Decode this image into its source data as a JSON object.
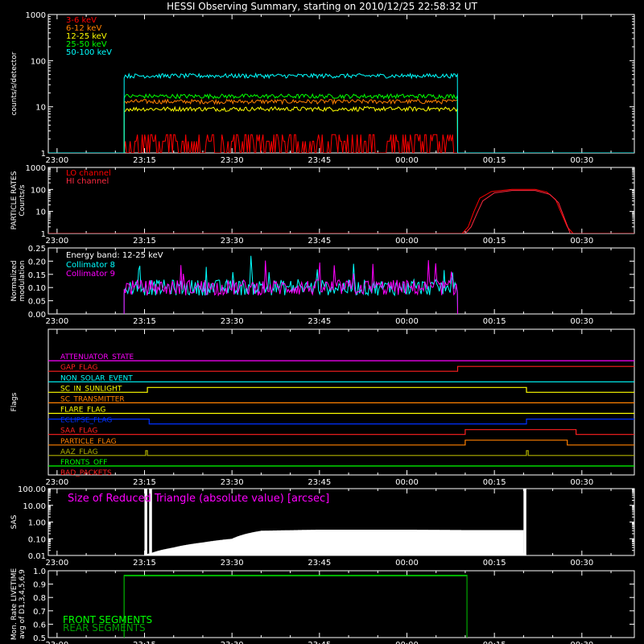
{
  "title": "HESSI Observing Summary, starting on 2010/12/25 22:58:32 UT",
  "colors": {
    "background": "#000000",
    "axis": "#ffffff",
    "red": "#ff0000",
    "orange": "#ff8000",
    "yellow": "#ffff00",
    "green": "#00ff00",
    "cyan": "#00ffff",
    "magenta": "#ff00ff",
    "dark_red": "#ff2a40",
    "blue": "#0030ff",
    "dark_green": "#00a000",
    "olive": "#b0b000"
  },
  "chart_data": [
    {
      "id": "count-rates",
      "type": "line",
      "ylabel": "counts/s/detector",
      "yscale": "log",
      "ylim": [
        1,
        1000
      ],
      "yticks": [
        1,
        10,
        100,
        1000
      ],
      "ytick_labels": [
        "1",
        "10",
        "100",
        "1000"
      ],
      "xlim": [
        -1.5,
        99
      ],
      "xticks": [
        0,
        15,
        30,
        45,
        60,
        75,
        90
      ],
      "xtick_labels": [
        "23:00",
        "23:15",
        "23:30",
        "23:45",
        "00:00",
        "00:15",
        "00:30"
      ],
      "series": [
        {
          "name": "3-6 keV",
          "color": "#ff0000",
          "x": [
            -1.5,
            11.5,
            11.5,
            68.7,
            68.7,
            99
          ],
          "y": [
            1,
            1,
            2.5,
            2.5,
            1,
            1
          ],
          "noise": 1
        },
        {
          "name": "6-12 keV",
          "color": "#ff8000",
          "x": [
            -1.5,
            11.5,
            11.5,
            68.7,
            68.7,
            99
          ],
          "y": [
            1,
            1,
            13,
            13,
            1,
            1
          ]
        },
        {
          "name": "12-25 keV",
          "color": "#ffff00",
          "x": [
            -1.5,
            11.5,
            11.5,
            68.7,
            68.7,
            99
          ],
          "y": [
            1,
            1,
            9,
            9,
            1,
            1
          ]
        },
        {
          "name": "25-50 keV",
          "color": "#00ff00",
          "x": [
            -1.5,
            11.5,
            11.5,
            68.7,
            68.7,
            99
          ],
          "y": [
            1,
            1,
            17,
            17,
            1,
            1
          ]
        },
        {
          "name": "50-100 keV",
          "color": "#00ffff",
          "x": [
            -1.5,
            11.5,
            11.5,
            68.7,
            68.7,
            99
          ],
          "y": [
            1,
            1,
            47,
            47,
            1,
            1
          ]
        }
      ]
    },
    {
      "id": "particle-rates",
      "type": "line",
      "ylabel": [
        "PARTICLE RATES",
        "Counts/s"
      ],
      "yscale": "log",
      "ylim": [
        1,
        1000
      ],
      "yticks": [
        1,
        10,
        100,
        1000
      ],
      "ytick_labels": [
        "1",
        "10",
        "100",
        "1000"
      ],
      "xlim": [
        -1.5,
        99
      ],
      "xticks": [
        0,
        15,
        30,
        45,
        60,
        75,
        90
      ],
      "xtick_labels": [
        "23:00",
        "23:15",
        "23:30",
        "23:45",
        "00:00",
        "00:15",
        "00:30"
      ],
      "series": [
        {
          "name": "LO channel",
          "color": "#ff0000",
          "x": [
            -1.5,
            69.5,
            70.5,
            71.5,
            72.5,
            74.5,
            78,
            82,
            84,
            85.5,
            86.5,
            87.5,
            88.5,
            99
          ],
          "y": [
            1,
            1,
            2,
            10,
            40,
            80,
            100,
            100,
            75,
            35,
            8,
            2,
            1,
            1
          ]
        },
        {
          "name": "HI channel",
          "color": "#ff2a40",
          "x": [
            -1.5,
            70,
            71,
            72,
            73,
            75,
            78,
            82,
            84.5,
            86,
            87,
            88,
            99
          ],
          "y": [
            1,
            1,
            2,
            8,
            30,
            70,
            90,
            90,
            60,
            25,
            5,
            1,
            1
          ]
        }
      ]
    },
    {
      "id": "modulation",
      "type": "line",
      "ylabel": [
        "Normalized",
        "modulation"
      ],
      "yscale": "linear",
      "ylim": [
        0,
        0.25
      ],
      "yticks": [
        0,
        0.05,
        0.1,
        0.15,
        0.2,
        0.25
      ],
      "ytick_labels": [
        "0.00",
        "0.05",
        "0.10",
        "0.15",
        "0.20",
        "0.25"
      ],
      "xlim": [
        -1.5,
        99
      ],
      "xticks": [
        0,
        15,
        30,
        45,
        60,
        75,
        90
      ],
      "xtick_labels": [
        "23:00",
        "23:15",
        "23:30",
        "23:45",
        "00:00",
        "00:15",
        "00:30"
      ],
      "annotation": "Energy band: 12-25 keV",
      "series": [
        {
          "name": "Collimator 8",
          "color": "#00ffff",
          "x": [
            11.5,
            68.7
          ],
          "y": [
            0.1,
            0.1
          ]
        },
        {
          "name": "Collimator 9",
          "color": "#ff00ff",
          "x": [
            11.5,
            68.7
          ],
          "y": [
            0.1,
            0.1
          ]
        }
      ]
    },
    {
      "id": "flags",
      "type": "line",
      "ylabel": "Flags",
      "xlim": [
        -1.5,
        99
      ],
      "xticks": [
        0,
        15,
        30,
        45,
        60,
        75,
        90
      ],
      "xtick_labels": [
        "23:00",
        "23:15",
        "23:30",
        "23:45",
        "00:00",
        "00:15",
        "00:30"
      ],
      "series": [
        {
          "name": "ATTENUATOR_STATE",
          "color": "#ff00ff",
          "x": [
            -1.5,
            99
          ],
          "y": [
            0,
            0
          ]
        },
        {
          "name": "GAP_FLAG",
          "color": "#ff2020",
          "x": [
            -1.5,
            68.7,
            68.7,
            99
          ],
          "y": [
            0,
            0,
            1,
            1
          ]
        },
        {
          "name": "NON_SOLAR_EVENT",
          "color": "#00ffff",
          "x": [
            -1.5,
            99
          ],
          "y": [
            0,
            0
          ]
        },
        {
          "name": "SC_IN_SUNLIGHT",
          "color": "#ffff00",
          "x": [
            -1.5,
            15.5,
            15.5,
            80.5,
            80.5,
            99
          ],
          "y": [
            0,
            0,
            1,
            1,
            0,
            0
          ]
        },
        {
          "name": "SC_TRANSMITTER",
          "color": "#ff8000",
          "x": [
            -1.5,
            99
          ],
          "y": [
            0,
            0
          ]
        },
        {
          "name": "FLARE_FLAG",
          "color": "#ffff00",
          "x": [
            -1.5,
            99
          ],
          "y": [
            0,
            0
          ]
        },
        {
          "name": "ECLIPSE_FLAG",
          "color": "#0030ff",
          "x": [
            -1.5,
            15.8,
            15.8,
            80.5,
            80.5,
            99
          ],
          "y": [
            1,
            1,
            0,
            0,
            1,
            1
          ]
        },
        {
          "name": "SAA_FLAG",
          "color": "#ff2020",
          "x": [
            -1.5,
            70,
            70,
            89,
            89,
            99
          ],
          "y": [
            0,
            0,
            1,
            1,
            0,
            0
          ]
        },
        {
          "name": "PARTICLE_FLAG",
          "color": "#ff8000",
          "x": [
            -1.5,
            70,
            70,
            87.5,
            87.5,
            99
          ],
          "y": [
            0,
            0,
            1,
            1,
            0,
            0
          ]
        },
        {
          "name": "AAZ_FLAG",
          "color": "#b0b000",
          "x": [
            -1.5,
            15.2,
            15.2,
            15.5,
            15.5,
            80.5,
            80.5,
            80.8,
            80.8,
            99
          ],
          "y": [
            0,
            0,
            1,
            1,
            0,
            0,
            1,
            1,
            0,
            0
          ]
        },
        {
          "name": "FRONTS_OFF",
          "color": "#00ff00",
          "x": [
            -1.5,
            99
          ],
          "y": [
            0,
            0
          ]
        },
        {
          "name": "BAD_PACKETS",
          "color": "#ff2020",
          "x": [
            -1.5,
            99
          ],
          "y": [
            0,
            0
          ]
        }
      ]
    },
    {
      "id": "sas",
      "type": "line",
      "ylabel": "SAS",
      "yscale": "log",
      "ylim": [
        0.01,
        100
      ],
      "yticks": [
        0.01,
        0.1,
        1,
        10,
        100
      ],
      "ytick_labels": [
        "0.01",
        "0.10",
        "1.00",
        "10.00",
        "100.00"
      ],
      "xlim": [
        -1.5,
        99
      ],
      "xticks": [
        0,
        15,
        30,
        45,
        60,
        75,
        90
      ],
      "xtick_labels": [
        "23:00",
        "23:15",
        "23:30",
        "23:45",
        "00:00",
        "00:15",
        "00:30"
      ],
      "annotation": "Size of Reduced Triangle (absolute value) [arcsec]",
      "series": [
        {
          "name": "Size of Reduced Triangle",
          "color": "#ffffff",
          "x": [
            15.2,
            20,
            25,
            30,
            35,
            45,
            60,
            70,
            80
          ],
          "y": [
            0.01,
            0.03,
            0.06,
            0.1,
            0.3,
            0.35,
            0.35,
            0.33,
            0.33
          ],
          "spikes": [
            15.2,
            16.0,
            80.2
          ]
        }
      ]
    },
    {
      "id": "livetime",
      "type": "line",
      "ylabel": [
        "Mon. Rate LIVETIME",
        "avg of D1,3,4,5,6,9"
      ],
      "yscale": "linear",
      "ylim": [
        0.5,
        1.0
      ],
      "yticks": [
        0.5,
        0.6,
        0.7,
        0.8,
        0.9,
        1.0
      ],
      "ytick_labels": [
        "0.5",
        "0.6",
        "0.7",
        "0.8",
        "0.9",
        "1.0"
      ],
      "xlim": [
        -1.5,
        99
      ],
      "xticks": [
        0,
        15,
        30,
        45,
        60,
        75,
        90
      ],
      "xtick_labels": [
        "23:00",
        "23:15",
        "23:30",
        "23:45",
        "00:00",
        "00:15",
        "00:30"
      ],
      "series": [
        {
          "name": "FRONT SEGMENTS",
          "color": "#00ff00",
          "x": [
            11.5,
            11.5,
            70.3,
            70.3
          ],
          "y": [
            0.5,
            0.965,
            0.965,
            0.5
          ]
        },
        {
          "name": "REAR SEGMENTS",
          "color": "#00a000",
          "x": [
            11.5,
            11.5,
            70.3,
            70.3
          ],
          "y": [
            0.5,
            0.96,
            0.96,
            0.5
          ]
        }
      ]
    }
  ]
}
